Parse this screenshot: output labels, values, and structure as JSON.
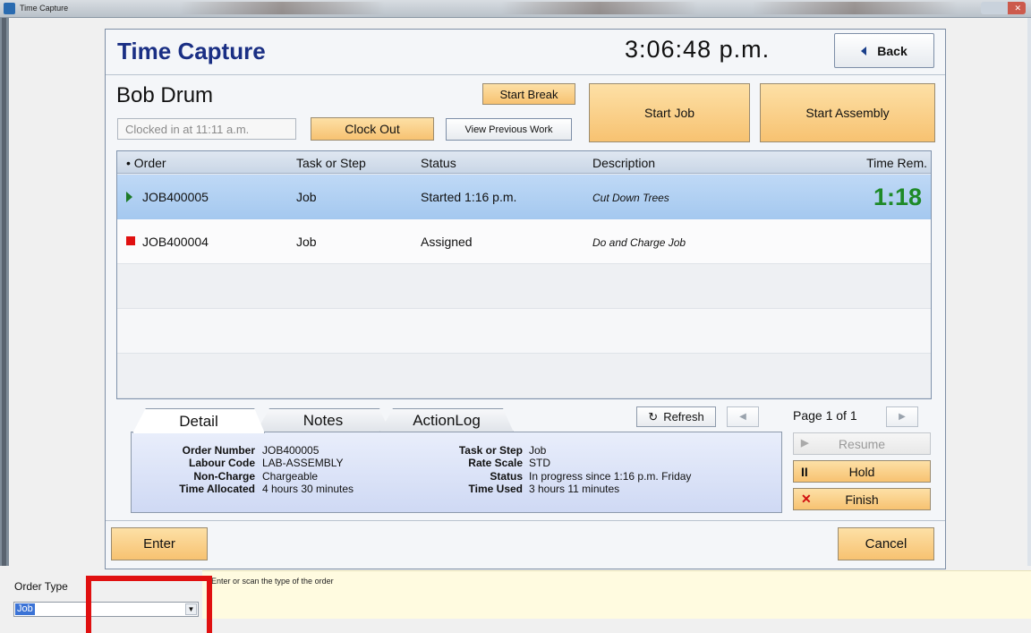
{
  "window": {
    "title": "Time Capture"
  },
  "header": {
    "app_title": "Time Capture",
    "clock": "3:06:48 p.m.",
    "back_label": "Back"
  },
  "employee": {
    "name": "Bob Drum",
    "clocked_in_text": "Clocked in at 11:11 a.m.",
    "clock_out_label": "Clock Out",
    "start_break_label": "Start Break",
    "view_previous_label": "View Previous Work",
    "start_job_label": "Start Job",
    "start_assembly_label": "Start Assembly"
  },
  "grid": {
    "columns": [
      "•  Order",
      "Task or Step",
      "Status",
      "Description",
      "Time Rem."
    ],
    "rows": [
      {
        "indicator": "play-icon",
        "order": "JOB400005",
        "task": "Job",
        "status": "Started 1:16 p.m.",
        "description": "Cut Down Trees",
        "time_rem": "1:18",
        "selected": true
      },
      {
        "indicator": "stop-icon",
        "order": "JOB400004",
        "task": "Job",
        "status": "Assigned",
        "description": "Do and Charge Job",
        "time_rem": "",
        "selected": false
      }
    ]
  },
  "tabs": [
    {
      "label": "Detail",
      "active": true
    },
    {
      "label": "Notes",
      "active": false
    },
    {
      "label": "ActionLog",
      "active": false
    }
  ],
  "pager": {
    "refresh_label": "Refresh",
    "page_text": "Page 1 of 1"
  },
  "detail": {
    "order_number_label": "Order Number",
    "order_number": "JOB400005",
    "labour_code_label": "Labour Code",
    "labour_code": "LAB-ASSEMBLY",
    "non_charge_label": "Non-Charge",
    "non_charge": "Chargeable",
    "time_allocated_label": "Time Allocated",
    "time_allocated": "4 hours 30 minutes",
    "task_label": "Task or Step",
    "task": "Job",
    "rate_scale_label": "Rate Scale",
    "rate_scale": "STD",
    "status_label": "Status",
    "status": "In progress since 1:16 p.m. Friday",
    "time_used_label": "Time Used",
    "time_used": "3 hours 11 minutes"
  },
  "actions": {
    "resume_label": "Resume",
    "hold_label": "Hold",
    "finish_label": "Finish"
  },
  "footer": {
    "enter_label": "Enter",
    "cancel_label": "Cancel"
  },
  "prompt": {
    "order_type_label": "Order Type",
    "order_type_value": "Job",
    "hint": "Enter or scan the type of the order"
  },
  "colors": {
    "title_blue": "#1a2f84",
    "orange_button": "#f7c271",
    "selected_row": "#a4c8ef",
    "time_green": "#1e8a28",
    "highlight_red": "#e01010"
  }
}
